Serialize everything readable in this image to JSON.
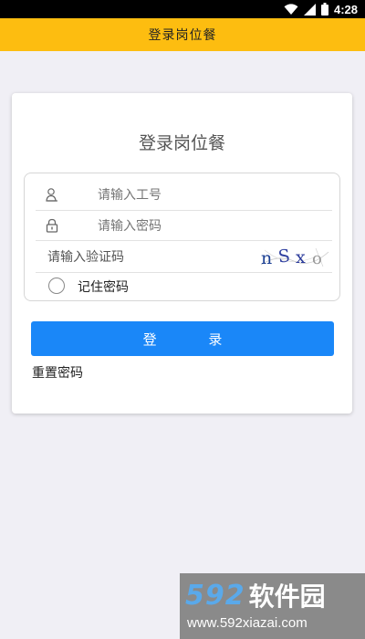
{
  "status_bar": {
    "time": "4:28"
  },
  "header": {
    "title": "登录岗位餐"
  },
  "login_card": {
    "title": "登录岗位餐",
    "employee_id": {
      "value": "",
      "placeholder": "请输入工号"
    },
    "password": {
      "value": "",
      "placeholder": "请输入密码"
    },
    "captcha": {
      "placeholder": "请输入验证码",
      "image_text": "nSxo"
    },
    "remember": {
      "label": "记住密码",
      "checked": false
    },
    "login_button": "登 录",
    "reset_link": "重置密码"
  },
  "watermark": {
    "brand_num": "592",
    "brand_cn": "软件园",
    "url": "www.592xiazai.com"
  },
  "colors": {
    "title_bar": "#fdbd10",
    "button": "#1a87f8",
    "background": "#f0eff5"
  }
}
